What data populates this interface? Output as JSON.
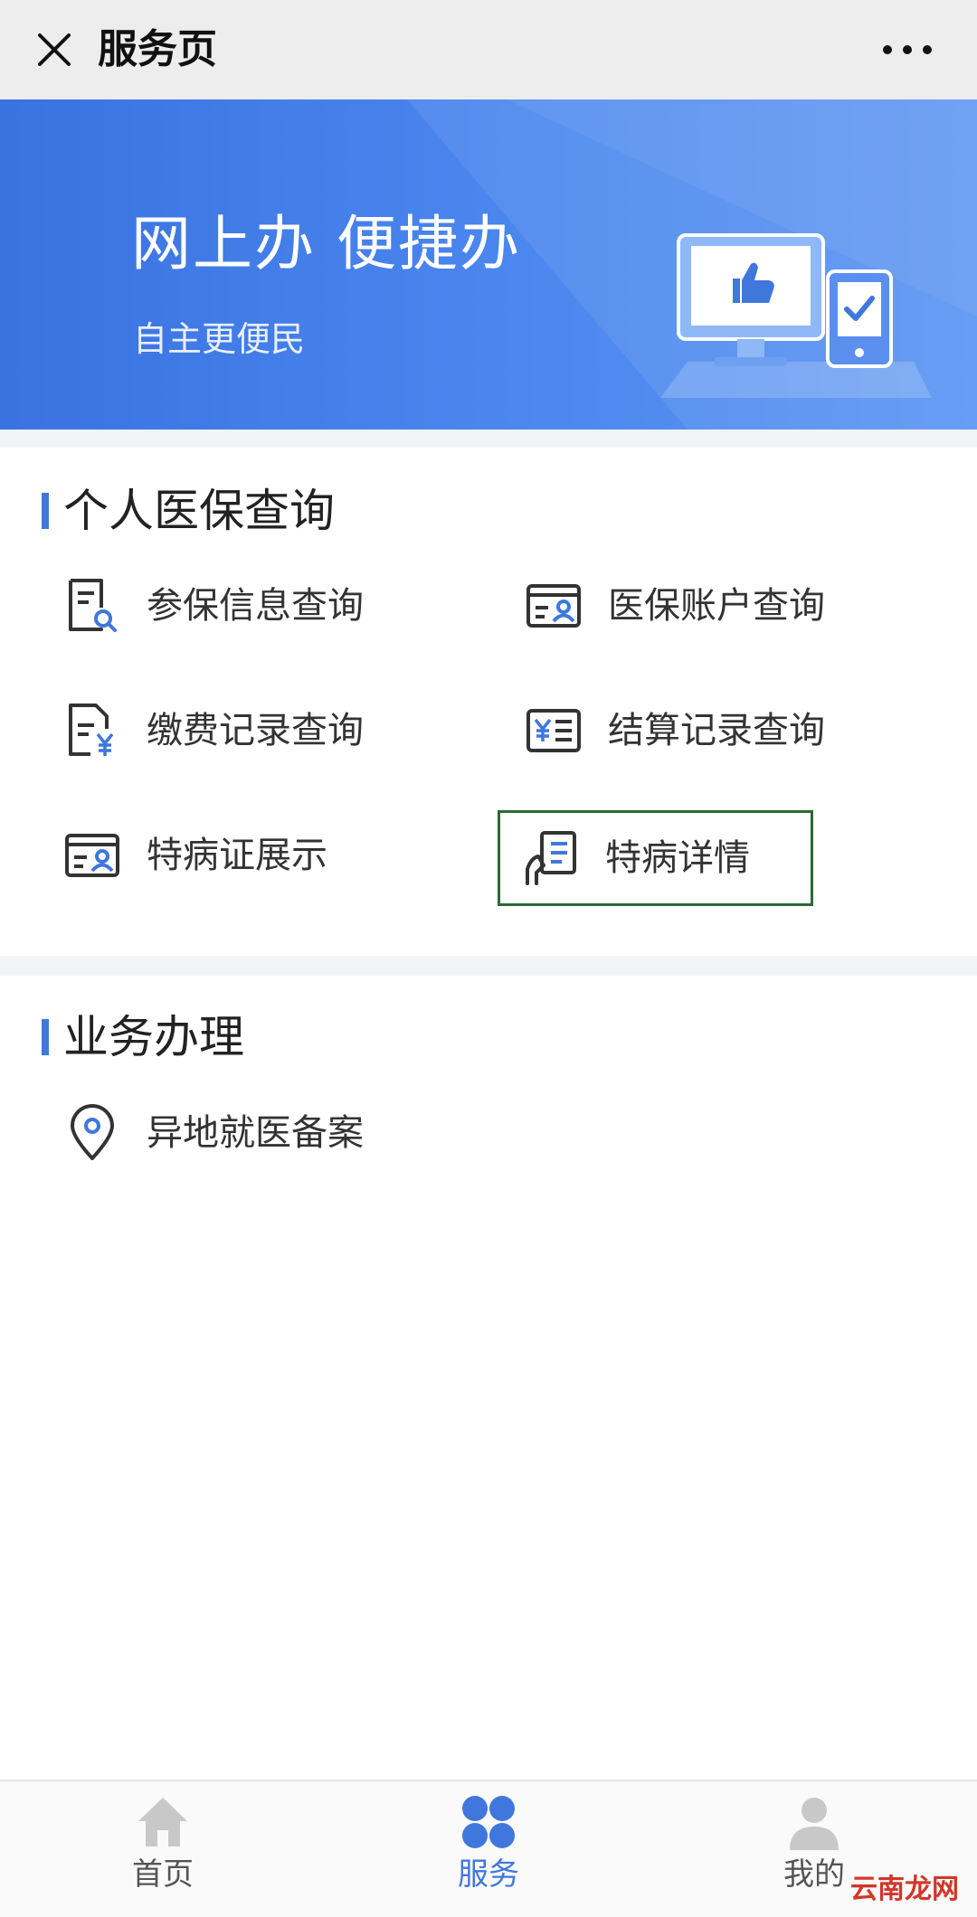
{
  "topbar": {
    "title": "服务页",
    "close_icon": "close-icon",
    "more_icon": "more-dots-icon"
  },
  "banner": {
    "headline": "网上办 便捷办",
    "subline": "自主更便民"
  },
  "sections": {
    "personal": {
      "title": "个人医保查询",
      "items": [
        {
          "label": "参保信息查询",
          "icon": "document-search-icon"
        },
        {
          "label": "医保账户查询",
          "icon": "id-card-icon"
        },
        {
          "label": "缴费记录查询",
          "icon": "document-yuan-icon"
        },
        {
          "label": "结算记录查询",
          "icon": "yuan-receipt-icon"
        },
        {
          "label": "特病证展示",
          "icon": "id-card-icon"
        },
        {
          "label": "特病详情",
          "icon": "hand-document-icon"
        }
      ]
    },
    "business": {
      "title": "业务办理",
      "items": [
        {
          "label": "异地就医备案",
          "icon": "location-pin-icon"
        }
      ]
    }
  },
  "tabbar": {
    "tabs": [
      {
        "label": "首页",
        "icon": "home-icon"
      },
      {
        "label": "服务",
        "icon": "grid-services-icon",
        "active": true
      },
      {
        "label": "我的",
        "icon": "user-icon"
      }
    ]
  },
  "watermark": "云南龙网",
  "colors": {
    "accent": "#3f77dd",
    "banner_start": "#3a72e0",
    "banner_end": "#5b95f2",
    "highlight_border": "#2c6a33",
    "watermark": "#d2362a"
  }
}
